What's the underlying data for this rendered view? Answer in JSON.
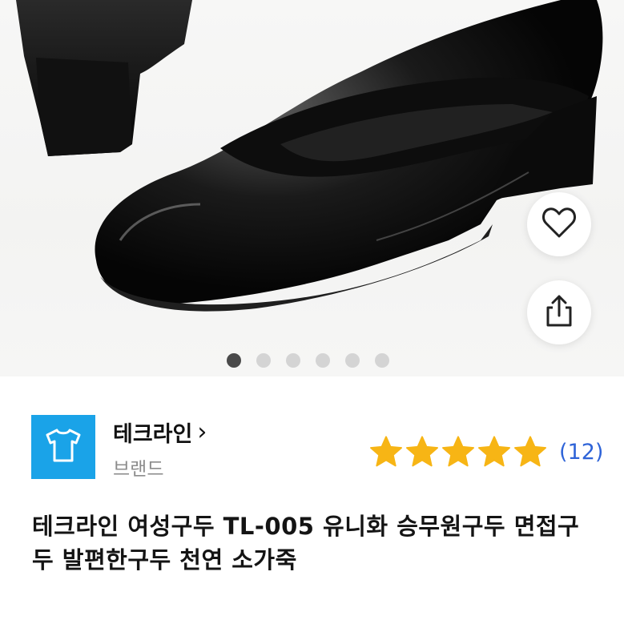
{
  "product_images": {
    "total": 6,
    "active_index": 0
  },
  "actions": {
    "like_icon": "heart-outline-icon",
    "share_icon": "share-icon"
  },
  "store": {
    "name": "테크라인",
    "chevron": "›",
    "type_label": "브랜드",
    "logo_icon": "t-shirt-icon",
    "logo_color": "#1aa3e8"
  },
  "rating": {
    "stars": 5,
    "review_count": "(12)",
    "star_color": "#f7b515",
    "link_color": "#2f64d8"
  },
  "product": {
    "title": "테크라인 여성구두 TL-005 유니화 승무원구두 면접구두 발편한구두 천연 소가죽"
  }
}
